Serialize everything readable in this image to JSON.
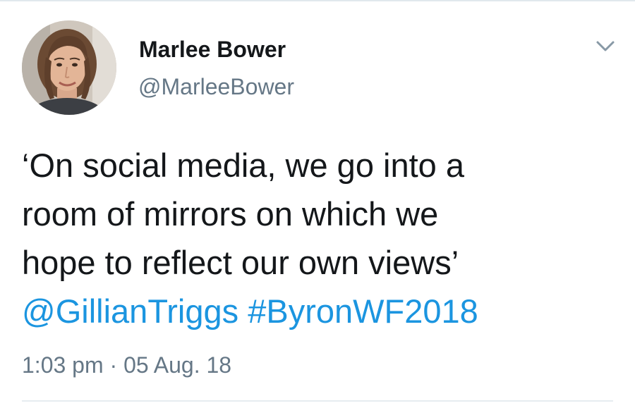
{
  "author": {
    "display_name": "Marlee Bower",
    "handle": "@MarleeBower"
  },
  "icons": {
    "avatar": "profile-photo",
    "menu": "chevron-down-icon"
  },
  "tweet": {
    "lines": [
      "‘On social media, we go into a",
      "room of mirrors on which we",
      "hope to reflect our own views’"
    ],
    "mention": "@GillianTriggs",
    "hashtag": "#ByronWF2018"
  },
  "meta": {
    "time": "1:03 pm",
    "separator": "·",
    "date": "05 Aug. 18"
  },
  "colors": {
    "text": "#14171a",
    "secondary": "#657786",
    "link": "#1b95e0"
  }
}
